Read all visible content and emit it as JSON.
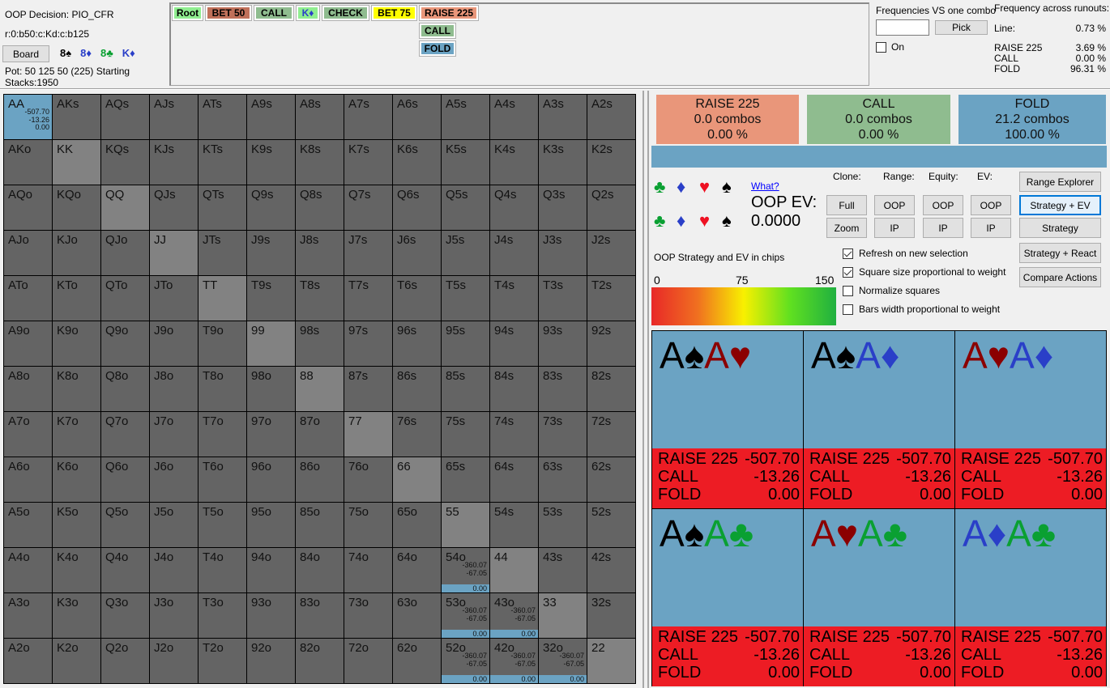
{
  "info": {
    "decision": "OOP Decision:  PIO_CFR",
    "line": "r:0:b50:c:Kd:c:b125",
    "board_button": "Board",
    "board_cards": [
      {
        "text": "8♠",
        "color": "#000000"
      },
      {
        "text": "8♦",
        "color": "#2a3fc8"
      },
      {
        "text": "8♣",
        "color": "#0aa032"
      },
      {
        "text": "K♦",
        "color": "#2a3fc8"
      }
    ],
    "pot": "Pot: 50 125 50 (225) Starting Stacks:1950"
  },
  "tree": {
    "path": [
      {
        "label": "Root",
        "color": "#90ee90"
      },
      {
        "label": "BET 50",
        "color": "#c0705a"
      },
      {
        "label": "CALL",
        "color": "#8fbc8f"
      },
      {
        "label": "K♦",
        "color": "#90ee90",
        "text_color": "#2a3fc8"
      },
      {
        "label": "CHECK",
        "color": "#8fbc8f"
      },
      {
        "label": "BET 75",
        "color": "#ffff00"
      },
      {
        "label": "RAISE 225",
        "color": "#e9967a"
      }
    ],
    "children": [
      {
        "label": "CALL",
        "color": "#8fbc8f"
      },
      {
        "label": "FOLD",
        "color": "#6ba3c3"
      }
    ]
  },
  "freq_vs_combo": {
    "title": "Frequencies VS one combo",
    "input_value": "",
    "pick_label": "Pick",
    "on_label": "On",
    "on_checked": false
  },
  "freq_runouts": {
    "title": "Frequency across runouts:",
    "line_label": "Line:",
    "line_value": "0.73 %",
    "actions": [
      {
        "name": "RAISE 225",
        "value": "3.69 %"
      },
      {
        "name": "CALL",
        "value": "0.00 %"
      },
      {
        "name": "FOLD",
        "value": "96.31 %"
      }
    ]
  },
  "grid": {
    "ranks": [
      "A",
      "K",
      "Q",
      "J",
      "T",
      "9",
      "8",
      "7",
      "6",
      "5",
      "4",
      "3",
      "2"
    ],
    "selected": "AA",
    "cell_values": {
      "AA": {
        "raise": "-507.70",
        "call": "-13.26",
        "fold": "0.00"
      },
      "54o": {
        "raise": "-360.07",
        "call": "-67.05",
        "fold": "0.00"
      },
      "53o": {
        "raise": "-360.07",
        "call": "-67.05",
        "fold": "0.00"
      },
      "43o": {
        "raise": "-360.07",
        "call": "-67.05",
        "fold": "0.00"
      },
      "52o": {
        "raise": "-360.07",
        "call": "-67.05",
        "fold": "0.00"
      },
      "42o": {
        "raise": "-360.07",
        "call": "-67.05",
        "fold": "0.00"
      },
      "32o": {
        "raise": "-360.07",
        "call": "-67.05",
        "fold": "0.00"
      }
    },
    "fold_color": "#6ba3c3"
  },
  "actions_summary": [
    {
      "name": "RAISE 225",
      "combos": "0.0 combos",
      "pct": "0.00 %",
      "color": "#e9967a"
    },
    {
      "name": "CALL",
      "combos": "0.0 combos",
      "pct": "0.00 %",
      "color": "#8fbc8f"
    },
    {
      "name": "FOLD",
      "combos": "21.2 combos",
      "pct": "100.00 %",
      "color": "#6ba3c3"
    }
  ],
  "suits_filter": [
    {
      "glyph": "♣",
      "color": "#0aa032"
    },
    {
      "glyph": "♦",
      "color": "#2a3fc8"
    },
    {
      "glyph": "♥",
      "color": "#ee1122"
    },
    {
      "glyph": "♠",
      "color": "#000000"
    }
  ],
  "what_link": "What?",
  "oop_ev": {
    "label": "OOP EV:",
    "value": "0.0000"
  },
  "clone": {
    "headers": [
      "Clone:",
      "Range:",
      "Equity:",
      "EV:"
    ],
    "row1": [
      "Full",
      "OOP",
      "OOP",
      "OOP"
    ],
    "row2": [
      "Zoom",
      "IP",
      "IP",
      "IP"
    ]
  },
  "view_buttons": [
    "Range Explorer",
    "Strategy + EV",
    "Strategy",
    "Strategy + React",
    "Compare Actions"
  ],
  "active_view": "Strategy + EV",
  "options": [
    {
      "label": "Refresh on new selection",
      "checked": true
    },
    {
      "label": "Square size proportional to weight",
      "checked": true
    },
    {
      "label": "Normalize squares",
      "checked": false
    },
    {
      "label": "Bars width proportional to weight",
      "checked": false
    }
  ],
  "legend": {
    "title": "OOP Strategy and EV in chips",
    "min": "0",
    "mid": "75",
    "max": "150"
  },
  "combos": [
    {
      "cards": [
        {
          "r": "A",
          "s": "♠",
          "c": "#000000"
        },
        {
          "r": "A",
          "s": "♥",
          "c": "#8b0000"
        }
      ],
      "evs": [
        {
          "a": "RAISE 225",
          "v": "-507.70"
        },
        {
          "a": "CALL",
          "v": "-13.26"
        },
        {
          "a": "FOLD",
          "v": "0.00"
        }
      ]
    },
    {
      "cards": [
        {
          "r": "A",
          "s": "♠",
          "c": "#000000"
        },
        {
          "r": "A",
          "s": "♦",
          "c": "#2a3fc8"
        }
      ],
      "evs": [
        {
          "a": "RAISE 225",
          "v": "-507.70"
        },
        {
          "a": "CALL",
          "v": "-13.26"
        },
        {
          "a": "FOLD",
          "v": "0.00"
        }
      ]
    },
    {
      "cards": [
        {
          "r": "A",
          "s": "♥",
          "c": "#8b0000"
        },
        {
          "r": "A",
          "s": "♦",
          "c": "#2a3fc8"
        }
      ],
      "evs": [
        {
          "a": "RAISE 225",
          "v": "-507.70"
        },
        {
          "a": "CALL",
          "v": "-13.26"
        },
        {
          "a": "FOLD",
          "v": "0.00"
        }
      ]
    },
    {
      "cards": [
        {
          "r": "A",
          "s": "♠",
          "c": "#000000"
        },
        {
          "r": "A",
          "s": "♣",
          "c": "#0aa032"
        }
      ],
      "evs": [
        {
          "a": "RAISE 225",
          "v": "-507.70"
        },
        {
          "a": "CALL",
          "v": "-13.26"
        },
        {
          "a": "FOLD",
          "v": "0.00"
        }
      ]
    },
    {
      "cards": [
        {
          "r": "A",
          "s": "♥",
          "c": "#8b0000"
        },
        {
          "r": "A",
          "s": "♣",
          "c": "#0aa032"
        }
      ],
      "evs": [
        {
          "a": "RAISE 225",
          "v": "-507.70"
        },
        {
          "a": "CALL",
          "v": "-13.26"
        },
        {
          "a": "FOLD",
          "v": "0.00"
        }
      ]
    },
    {
      "cards": [
        {
          "r": "A",
          "s": "♦",
          "c": "#2a3fc8"
        },
        {
          "r": "A",
          "s": "♣",
          "c": "#0aa032"
        }
      ],
      "evs": [
        {
          "a": "RAISE 225",
          "v": "-507.70"
        },
        {
          "a": "CALL",
          "v": "-13.26"
        },
        {
          "a": "FOLD",
          "v": "0.00"
        }
      ]
    }
  ]
}
